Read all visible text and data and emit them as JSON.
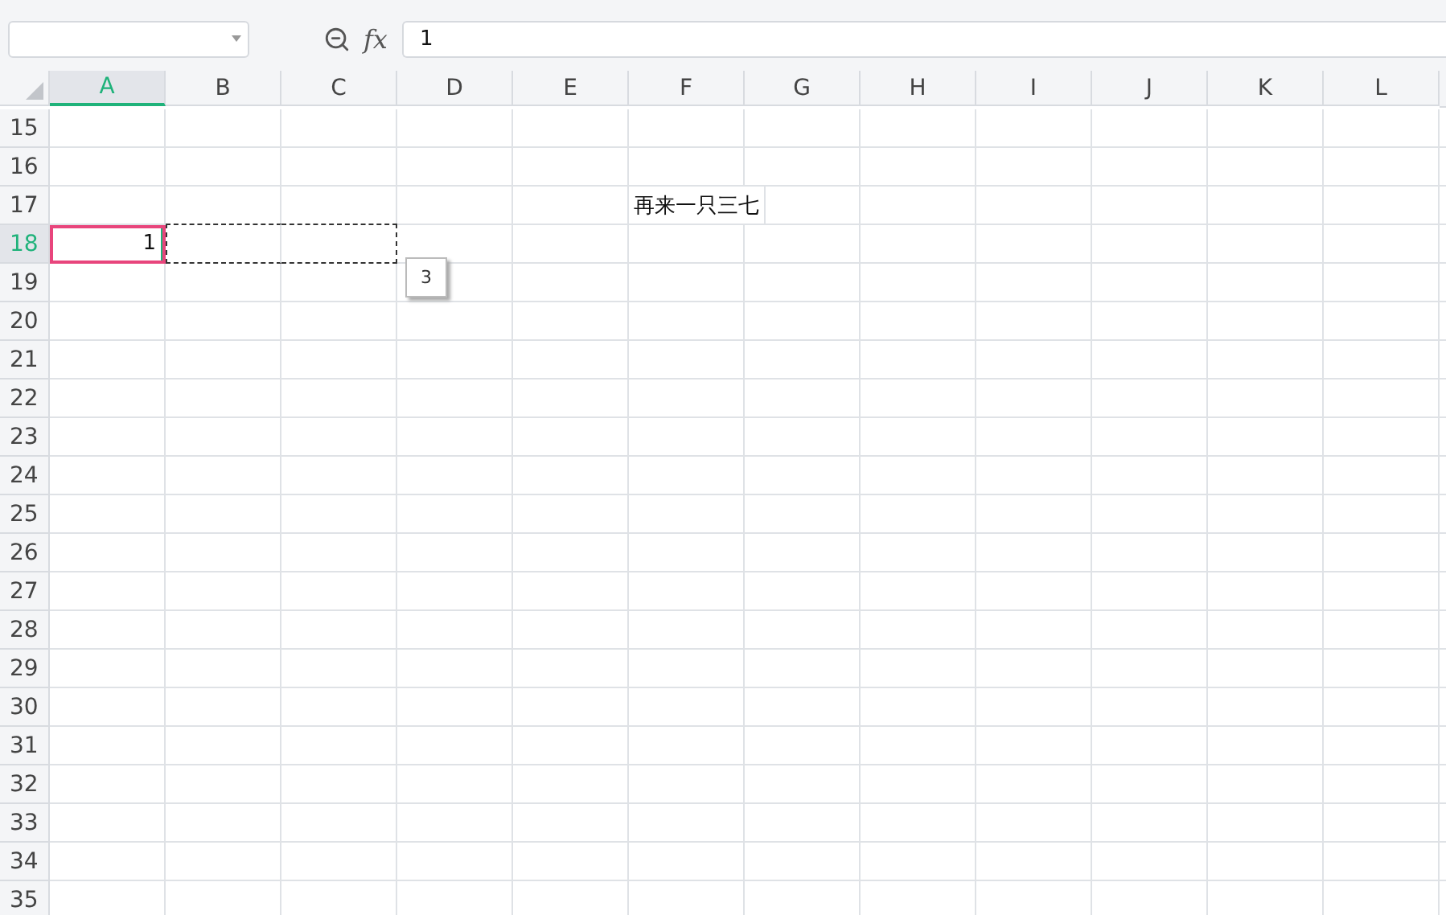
{
  "formula_bar": {
    "function_label": "fx",
    "value": "1"
  },
  "columns": [
    {
      "label": "A",
      "selected": true
    },
    {
      "label": "B",
      "selected": false
    },
    {
      "label": "C",
      "selected": false
    },
    {
      "label": "D",
      "selected": false
    },
    {
      "label": "E",
      "selected": false
    },
    {
      "label": "F",
      "selected": false
    },
    {
      "label": "G",
      "selected": false
    },
    {
      "label": "H",
      "selected": false
    },
    {
      "label": "I",
      "selected": false
    },
    {
      "label": "J",
      "selected": false
    },
    {
      "label": "K",
      "selected": false
    },
    {
      "label": "L",
      "selected": false
    }
  ],
  "rows": [
    {
      "label": "15",
      "selected": false,
      "cells": []
    },
    {
      "label": "16",
      "selected": false,
      "cells": []
    },
    {
      "label": "17",
      "selected": false,
      "cells": [
        null,
        null,
        null,
        null,
        null,
        {
          "text": "再来一只三七",
          "selected": false,
          "copied": false
        }
      ]
    },
    {
      "label": "18",
      "selected": true,
      "cells": [
        {
          "text": "1",
          "selected": true,
          "copied": false
        },
        {
          "selected": false,
          "copied": true
        },
        {
          "selected": false,
          "copied": true
        }
      ]
    },
    {
      "label": "19",
      "selected": false,
      "cells": []
    },
    {
      "label": "20",
      "selected": false,
      "cells": []
    },
    {
      "label": "21",
      "selected": false,
      "cells": []
    },
    {
      "label": "22",
      "selected": false,
      "cells": []
    },
    {
      "label": "23",
      "selected": false,
      "cells": []
    },
    {
      "label": "24",
      "selected": false,
      "cells": []
    },
    {
      "label": "25",
      "selected": false,
      "cells": []
    },
    {
      "label": "26",
      "selected": false,
      "cells": []
    },
    {
      "label": "27",
      "selected": false,
      "cells": []
    },
    {
      "label": "28",
      "selected": false,
      "cells": []
    },
    {
      "label": "29",
      "selected": false,
      "cells": []
    },
    {
      "label": "30",
      "selected": false,
      "cells": []
    },
    {
      "label": "31",
      "selected": false,
      "cells": []
    },
    {
      "label": "32",
      "selected": false,
      "cells": []
    },
    {
      "label": "33",
      "selected": false,
      "cells": []
    },
    {
      "label": "34",
      "selected": false,
      "cells": []
    },
    {
      "label": "35",
      "selected": false,
      "cells": []
    }
  ],
  "paste_hint": {
    "text": "3"
  }
}
